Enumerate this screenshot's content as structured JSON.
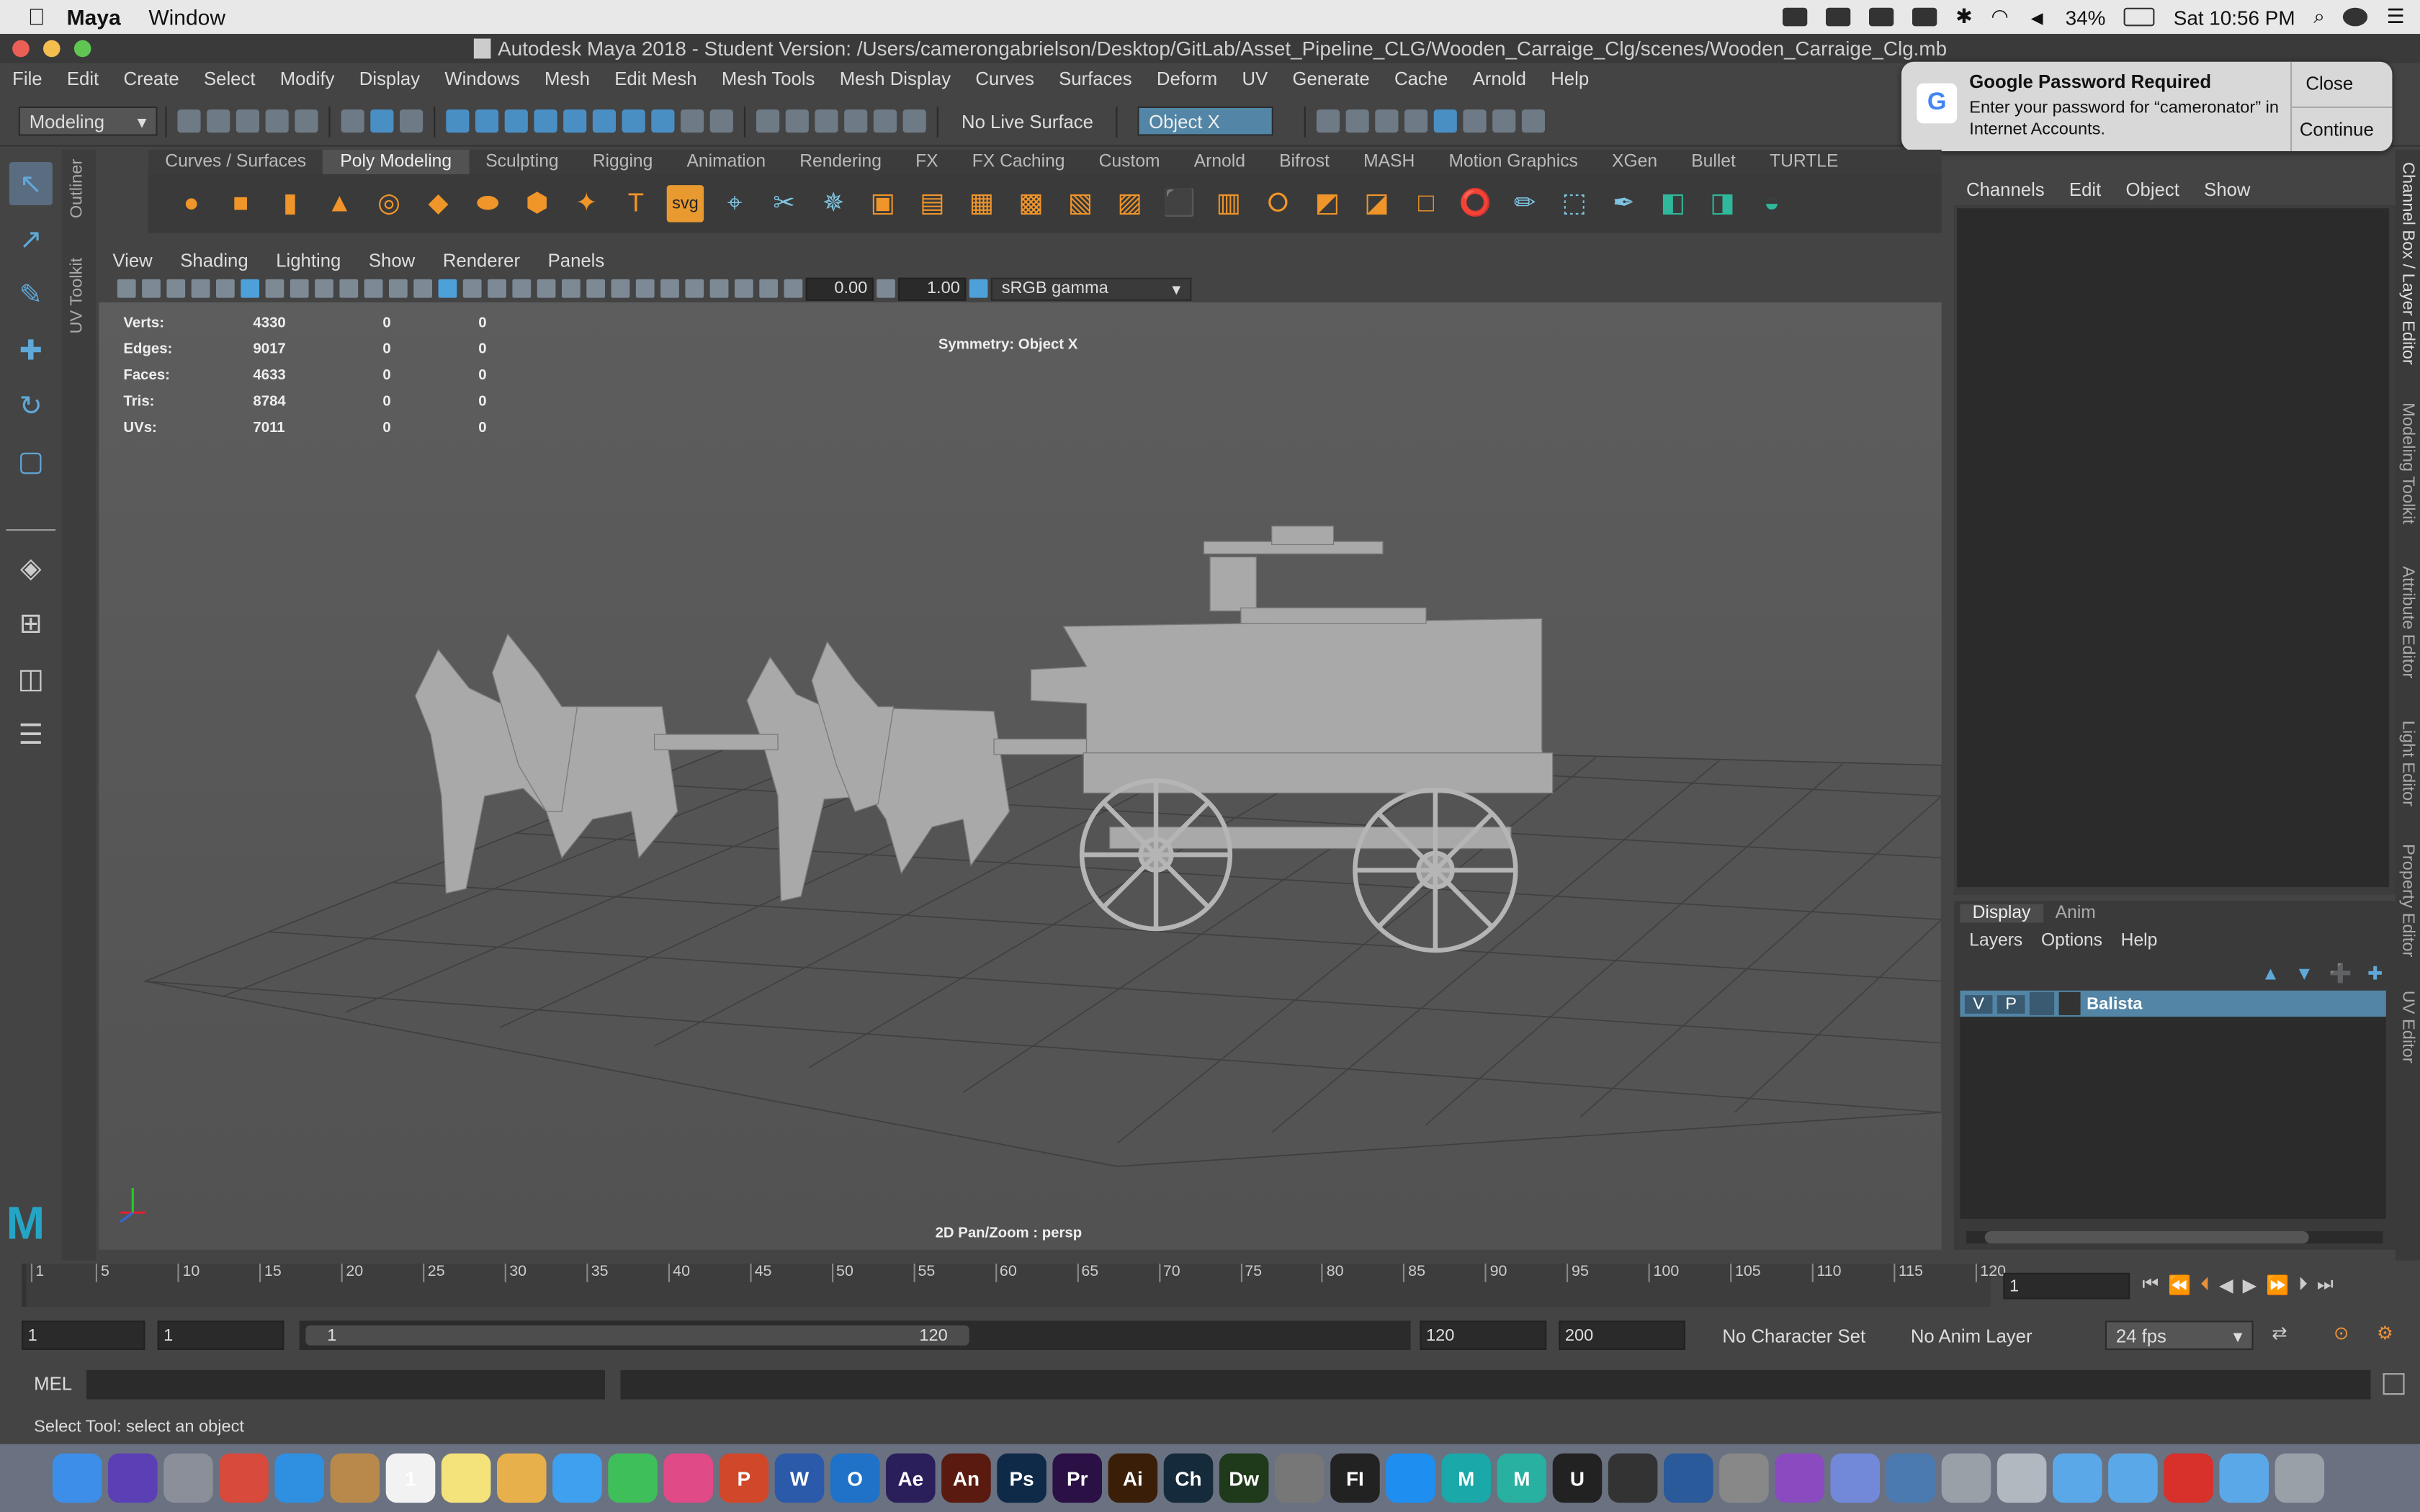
{
  "mac_menubar": {
    "app_name": "Maya",
    "items": [
      "Window"
    ],
    "battery": "34%",
    "clock": "Sat 10:56 PM"
  },
  "window": {
    "title": "Autodesk Maya 2018 - Student Version: /Users/camerongabrielson/Desktop/GitLab/Asset_Pipeline_CLG/Wooden_Carraige_Clg/scenes/Wooden_Carraige_Clg.mb"
  },
  "main_menu": [
    "File",
    "Edit",
    "Create",
    "Select",
    "Modify",
    "Display",
    "Windows",
    "Mesh",
    "Edit Mesh",
    "Mesh Tools",
    "Mesh Display",
    "Curves",
    "Surfaces",
    "Deform",
    "UV",
    "Generate",
    "Cache",
    "Arnold",
    "Help"
  ],
  "status_line": {
    "menu_set": "Modeling",
    "live_surface": "No Live Surface",
    "symmetry": "Object X"
  },
  "shelf": {
    "tabs": [
      "Curves / Surfaces",
      "Poly Modeling",
      "Sculpting",
      "Rigging",
      "Animation",
      "Rendering",
      "FX",
      "FX Caching",
      "Custom",
      "Arnold",
      "Bifrost",
      "MASH",
      "Motion Graphics",
      "XGen",
      "Bullet",
      "TURTLE"
    ],
    "active_tab": "Poly Modeling",
    "svg_label": "svg"
  },
  "side_labels": {
    "outliner": "Outliner",
    "uv_toolkit": "UV Toolkit"
  },
  "viewport": {
    "menu": [
      "View",
      "Shading",
      "Lighting",
      "Show",
      "Renderer",
      "Panels"
    ],
    "exposure": "0.00",
    "gamma": "1.00",
    "color_space": "sRGB gamma",
    "symmetry_hud": "Symmetry: Object X",
    "camera_label": "2D Pan/Zoom : persp",
    "stats": [
      {
        "label": "Verts:",
        "v1": "4330",
        "v2": "0",
        "v3": "0"
      },
      {
        "label": "Edges:",
        "v1": "9017",
        "v2": "0",
        "v3": "0"
      },
      {
        "label": "Faces:",
        "v1": "4633",
        "v2": "0",
        "v3": "0"
      },
      {
        "label": "Tris:",
        "v1": "8784",
        "v2": "0",
        "v3": "0"
      },
      {
        "label": "UVs:",
        "v1": "7011",
        "v2": "0",
        "v3": "0"
      }
    ]
  },
  "channel_box": {
    "menu": [
      "Channels",
      "Edit",
      "Object",
      "Show"
    ]
  },
  "layer_editor": {
    "tabs": [
      "Display",
      "Anim"
    ],
    "active_tab": "Display",
    "menu": [
      "Layers",
      "Options",
      "Help"
    ],
    "layers": [
      {
        "v": "V",
        "p": "P",
        "name": "Balista"
      }
    ]
  },
  "right_vertical_tabs": [
    "Channel Box / Layer Editor",
    "Modeling Toolkit",
    "Attribute Editor",
    "Light Editor",
    "Property Editor",
    "UV Editor"
  ],
  "notification": {
    "title": "Google Password Required",
    "body": "Enter your password for “cameronator” in Internet Accounts.",
    "close": "Close",
    "continue": "Continue"
  },
  "time_slider": {
    "ticks": [
      "1",
      "5",
      "10",
      "15",
      "20",
      "25",
      "30",
      "35",
      "40",
      "45",
      "50",
      "55",
      "60",
      "65",
      "70",
      "75",
      "80",
      "85",
      "90",
      "95",
      "100",
      "105",
      "110",
      "115",
      "120"
    ],
    "current_frame": "1"
  },
  "range_slider": {
    "start": "1",
    "playback_start": "1",
    "range_left": "1",
    "range_right": "120",
    "playback_end": "120",
    "end": "200",
    "character_set": "No Character Set",
    "anim_layer": "No Anim Layer",
    "fps": "24 fps"
  },
  "command_line": {
    "label": "MEL"
  },
  "help_line": {
    "text": "Select Tool: select an object"
  },
  "dock_apps": [
    {
      "name": "finder-icon",
      "label": "",
      "color": "#3d8ee8"
    },
    {
      "name": "siri-icon",
      "label": "",
      "color": "#5b3fb5"
    },
    {
      "name": "launchpad-icon",
      "label": "",
      "color": "#8a8f99"
    },
    {
      "name": "chrome-icon",
      "label": "",
      "color": "#d84a3c"
    },
    {
      "name": "safari-icon",
      "label": "",
      "color": "#2f8fe0"
    },
    {
      "name": "notefile-icon",
      "label": "",
      "color": "#b8894a"
    },
    {
      "name": "calendar-icon",
      "label": "1",
      "color": "#f2f2f2"
    },
    {
      "name": "notes-icon",
      "label": "",
      "color": "#f4e27a"
    },
    {
      "name": "photos-icon",
      "label": "",
      "color": "#e8b04a"
    },
    {
      "name": "messages-icon",
      "label": "",
      "color": "#3fa0f0"
    },
    {
      "name": "facetime-icon",
      "label": "",
      "color": "#3fbf5a"
    },
    {
      "name": "itunes-icon",
      "label": "",
      "color": "#e04a86"
    },
    {
      "name": "powerpoint-icon",
      "label": "P",
      "color": "#d0472a"
    },
    {
      "name": "word-icon",
      "label": "W",
      "color": "#2b5aaa"
    },
    {
      "name": "outlook-icon",
      "label": "O",
      "color": "#1f72c8"
    },
    {
      "name": "after-effects-icon",
      "label": "Ae",
      "color": "#2a1f5a"
    },
    {
      "name": "animate-icon",
      "label": "An",
      "color": "#5a1a10"
    },
    {
      "name": "photoshop-icon",
      "label": "Ps",
      "color": "#0f2a48"
    },
    {
      "name": "premiere-icon",
      "label": "Pr",
      "color": "#2a1044"
    },
    {
      "name": "illustrator-icon",
      "label": "Ai",
      "color": "#3a1e08"
    },
    {
      "name": "character-animator-icon",
      "label": "Ch",
      "color": "#152a3a"
    },
    {
      "name": "dreamweaver-icon",
      "label": "Dw",
      "color": "#1e3a1a"
    },
    {
      "name": "pen-icon",
      "label": "",
      "color": "#777"
    },
    {
      "name": "fi-icon",
      "label": "FI",
      "color": "#222"
    },
    {
      "name": "app-store-icon",
      "label": "",
      "color": "#1e8ef0"
    },
    {
      "name": "maya-icon",
      "label": "M",
      "color": "#1aa8a8"
    },
    {
      "name": "mudbox-icon",
      "label": "M",
      "color": "#28b0a0"
    },
    {
      "name": "unreal-icon",
      "label": "U",
      "color": "#222"
    },
    {
      "name": "unity-icon",
      "label": "",
      "color": "#333"
    },
    {
      "name": "blender-like-icon",
      "label": "",
      "color": "#2a5a9a"
    },
    {
      "name": "system-preferences-icon",
      "label": "",
      "color": "#888"
    },
    {
      "name": "github-icon",
      "label": "",
      "color": "#8a4ac0"
    },
    {
      "name": "discord-icon",
      "label": "",
      "color": "#7289da"
    },
    {
      "name": "virtualbox-icon",
      "label": "",
      "color": "#4a7ab0"
    },
    {
      "name": "utility-icon",
      "label": "",
      "color": "#9aa0a8"
    },
    {
      "name": "preview-icon",
      "label": "",
      "color": "#b0b8c0"
    },
    {
      "name": "folder-icon",
      "label": "",
      "color": "#5aa8e8"
    },
    {
      "name": "folder2-icon",
      "label": "",
      "color": "#5aa8e8"
    },
    {
      "name": "creative-cloud-icon",
      "label": "",
      "color": "#d8302a"
    },
    {
      "name": "folder3-icon",
      "label": "",
      "color": "#5aa8e8"
    },
    {
      "name": "trash-icon",
      "label": "",
      "color": "#9aa0a8"
    }
  ],
  "colors": {
    "accent": "#5285a6",
    "layer_row": "#5285a6",
    "shelf_icon": "#f0952a"
  }
}
